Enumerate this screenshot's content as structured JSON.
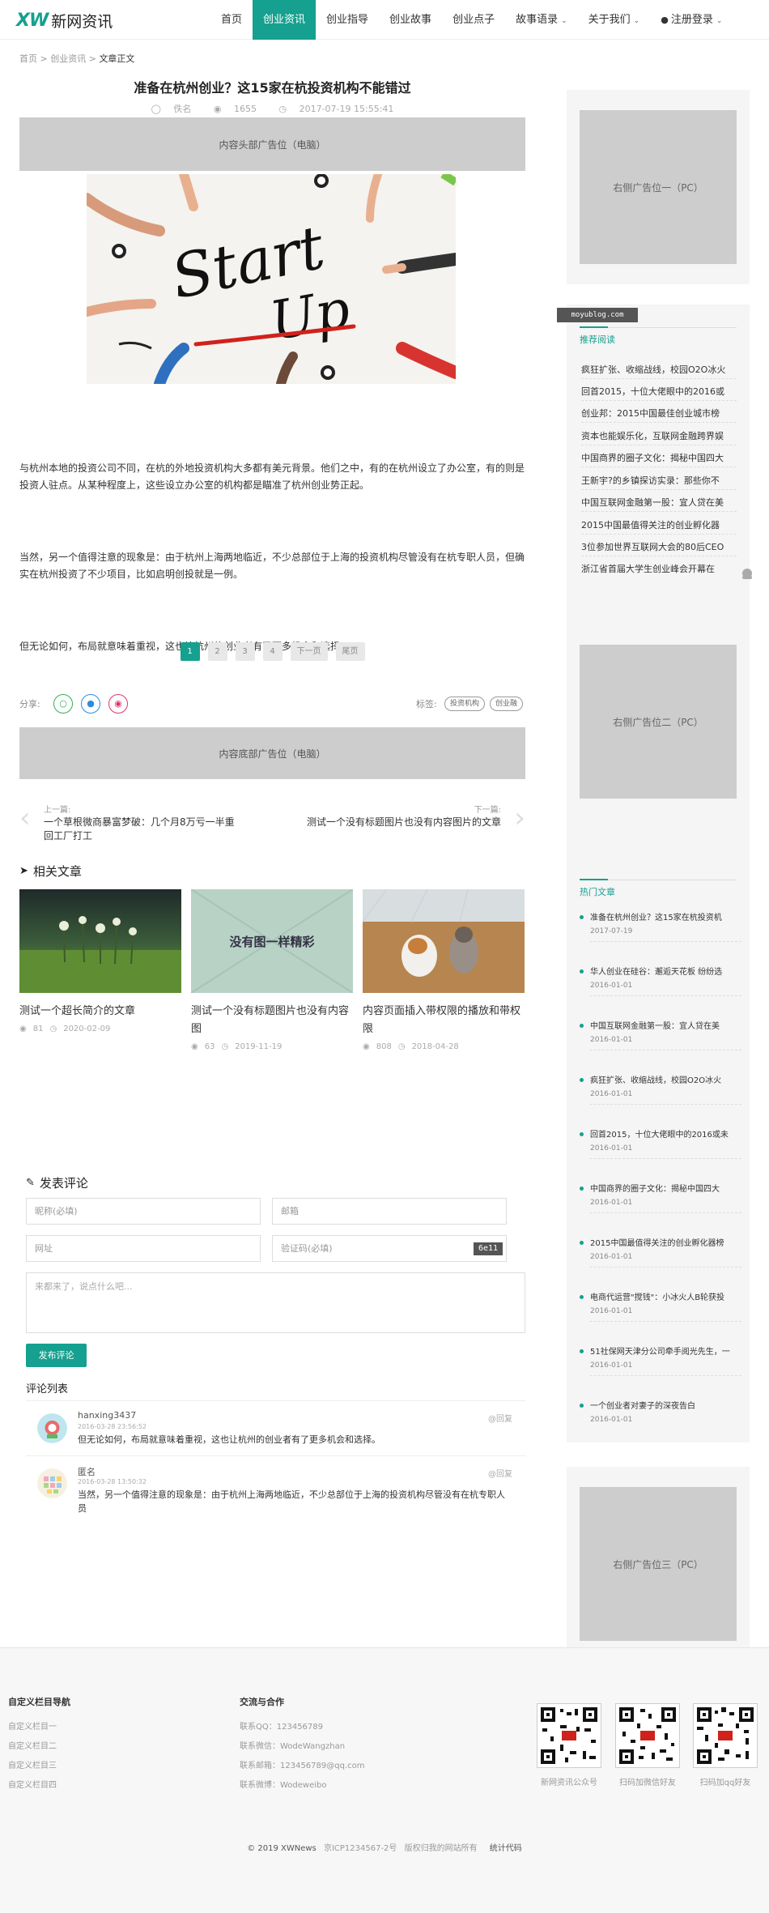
{
  "header": {
    "logo_mark": "XW",
    "logo_text": "新网资讯",
    "nav": [
      {
        "label": "首页",
        "active": false
      },
      {
        "label": "创业资讯",
        "active": true
      },
      {
        "label": "创业指导",
        "active": false
      },
      {
        "label": "创业故事",
        "active": false
      },
      {
        "label": "创业点子",
        "active": false
      },
      {
        "label": "故事语录",
        "active": false,
        "dropdown": true
      },
      {
        "label": "关于我们",
        "active": false,
        "dropdown": true
      },
      {
        "label": "注册登录",
        "active": false,
        "dropdown": true,
        "user": true
      }
    ]
  },
  "breadcrumb": {
    "home": "首页",
    "sep": ">",
    "category": "创业资讯",
    "current": "文章正文"
  },
  "article": {
    "title": "准备在杭州创业？这15家在杭投资机构不能错过",
    "author": "佚名",
    "views": "1655",
    "date": "2017-07-19 15:55:41",
    "ad_top": "内容头部广告位（电脑）",
    "hero_text": "Start Up",
    "paragraphs": [
      "与杭州本地的投资公司不同，在杭的外地投资机构大多都有美元背景。他们之中，有的在杭州设立了办公室，有的则是投资人驻点。从某种程度上，这些设立办公室的机构都是瞄准了杭州创业势正起。",
      "当然，另一个值得注意的现象是：由于杭州上海两地临近，不少总部位于上海的投资机构尽管没有在杭专职人员，但确实在杭州投资了不少项目，比如启明创投就是一例。",
      "但无论如何，布局就意味着重视，这也让杭州的创业者有了更多机会和选择。"
    ],
    "pager": [
      "1",
      "2",
      "3",
      "4",
      "下一页",
      "尾页"
    ],
    "share_label": "分享:",
    "tags_label": "标签:",
    "tags": [
      "投资机构",
      "创业融"
    ],
    "ad_bottom": "内容底部广告位（电脑）",
    "prev_label": "上一篇:",
    "prev_title": "一个草根微商暴富梦破：几个月8万亏一半重回工厂打工",
    "next_label": "下一篇:",
    "next_title": "测试一个没有标题图片也没有内容图片的文章"
  },
  "related": {
    "title": "相关文章",
    "items": [
      {
        "title": "测试一个超长简介的文章",
        "views": "81",
        "date": "2020-02-09",
        "img_text": ""
      },
      {
        "title": "测试一个没有标题图片也没有内容图",
        "views": "63",
        "date": "2019-11-19",
        "img_text": "没有图一样精彩"
      },
      {
        "title": "内容页面插入带权限的播放和带权限",
        "views": "808",
        "date": "2018-04-28",
        "img_text": ""
      }
    ]
  },
  "comment_form": {
    "title": "发表评论",
    "name_placeholder": "昵称(必填)",
    "email_placeholder": "邮箱",
    "url_placeholder": "网址",
    "captcha_placeholder": "验证码(必填)",
    "captcha_code": "6e11",
    "content_placeholder": "来都来了，说点什么吧...",
    "submit": "发布评论"
  },
  "comments": {
    "title": "评论列表",
    "reply_label": "@回复",
    "items": [
      {
        "name": "hanxing3437",
        "time": "2016-03-28 23:56:52",
        "text": "但无论如何，布局就意味着重视，这也让杭州的创业者有了更多机会和选择。"
      },
      {
        "name": "匿名",
        "time": "2016-03-28 13:50:32",
        "text": "当然，另一个值得注意的现象是：由于杭州上海两地临近，不少总部位于上海的投资机构尽管没有在杭专职人员"
      }
    ]
  },
  "sidebar": {
    "ad1": "右侧广告位一（PC）",
    "watermark": "moyublog.com",
    "recommend_title": "推荐阅读",
    "recommend": [
      "疯狂扩张、收缩战线，校园O2O冰火",
      "回首2015，十位大佬眼中的2016或",
      "创业邦：2015中国最佳创业城市榜",
      "资本也能娱乐化，互联网金融跨界娱",
      "中国商界的圈子文化：揭秘中国四大",
      "王新宇?的乡镇探访实录：那些你不",
      "中国互联网金融第一股：宜人贷在美",
      "2015中国最值得关注的创业孵化器",
      "3位参加世界互联网大会的80后CEO",
      "浙江省首届大学生创业峰会开幕在"
    ],
    "ad2": "右侧广告位二（PC）",
    "hot_title": "热门文章",
    "hot": [
      {
        "title": "准备在杭州创业？这15家在杭投资机",
        "date": "2017-07-19"
      },
      {
        "title": "华人创业在硅谷：邂逅天花板 纷纷选",
        "date": "2016-01-01"
      },
      {
        "title": "中国互联网金融第一股：宜人贷在美",
        "date": "2016-01-01"
      },
      {
        "title": "疯狂扩张、收缩战线，校园O2O冰火",
        "date": "2016-01-01"
      },
      {
        "title": "回首2015，十位大佬眼中的2016或未",
        "date": "2016-01-01"
      },
      {
        "title": "中国商界的圈子文化：揭秘中国四大",
        "date": "2016-01-01"
      },
      {
        "title": "2015中国最值得关注的创业孵化器榜",
        "date": "2016-01-01"
      },
      {
        "title": "电商代运营\"搅钱\"：小冰火人B轮获投",
        "date": "2016-01-01"
      },
      {
        "title": "51社保网天津分公司牵手阅光先生，一",
        "date": "2016-01-01"
      },
      {
        "title": "一个创业者对妻子的深夜告白",
        "date": "2016-01-01"
      }
    ],
    "ad3": "右侧广告位三（PC）"
  },
  "footer": {
    "col1_title": "自定义栏目导航",
    "col1_links": [
      "自定义栏目一",
      "自定义栏目二",
      "自定义栏目三",
      "自定义栏目四"
    ],
    "col2_title": "交流与合作",
    "col2_links": [
      "联系QQ：123456789",
      "联系微信：WodeWangzhan",
      "联系邮箱：123456789@qq.com",
      "联系微博：Wodeweibo"
    ],
    "qr_labels": [
      "新网资讯公众号",
      "扫码加微信好友",
      "扫码加qq好友"
    ],
    "copyright": "© 2019 XWNews",
    "icp": "京ICP1234567-2号",
    "rights": "版权归我的网站所有",
    "stats": "统计代码"
  },
  "colors": {
    "accent": "#16a08f",
    "ad_gray": "#cdcdcd"
  }
}
